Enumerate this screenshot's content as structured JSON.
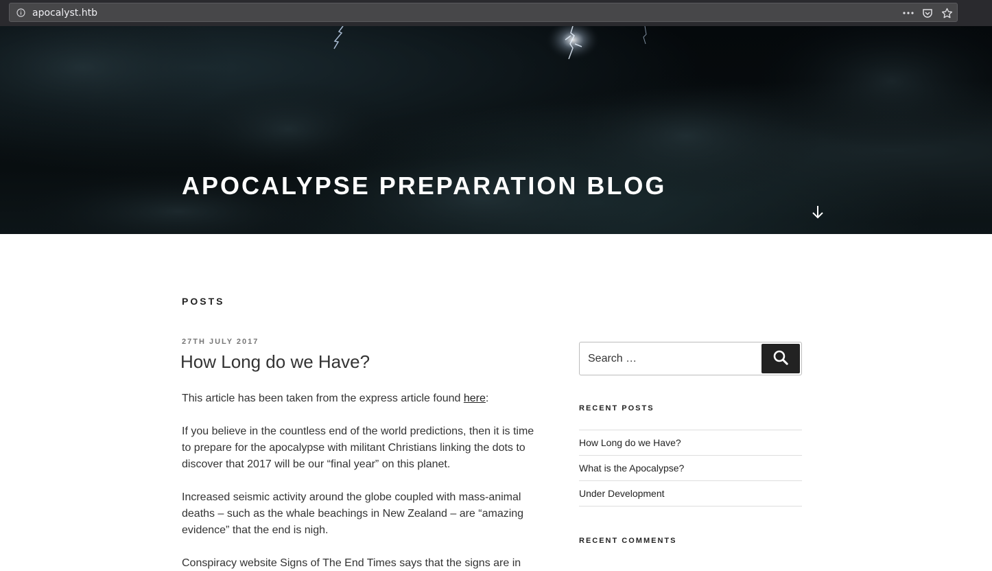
{
  "browser": {
    "url": "apocalyst.htb",
    "icons": [
      "info-icon",
      "more-actions-icon",
      "pocket-icon",
      "bookmark-star-icon"
    ]
  },
  "header": {
    "site_title": "APOCALYPSE PREPARATION BLOG",
    "scroll_icon": "arrow-down-icon"
  },
  "main": {
    "section_heading": "POSTS",
    "post": {
      "date": "27TH JULY 2017",
      "title": "How Long do we Have?",
      "intro_before_link": "This article has been taken from the express article found ",
      "intro_link": "here",
      "intro_after_link": ":",
      "paragraphs": [
        "If you believe in the countless end of the world predictions, then it is time to prepare for the apocalypse with militant Christians linking the dots to discover that 2017 will be our “final year” on this planet.",
        "Increased seismic activity around the globe coupled with mass-animal deaths – such as the whale beachings in New Zealand – are “amazing evidence” that the end is nigh.",
        "Conspiracy website Signs of The End Times says that the signs are in"
      ]
    }
  },
  "sidebar": {
    "search": {
      "placeholder": "Search …",
      "button_label": "Search",
      "icon": "search-icon"
    },
    "recent_posts": {
      "title": "RECENT POSTS",
      "items": [
        "How Long do we Have?",
        "What is the Apocalypse?",
        "Under Development"
      ]
    },
    "recent_comments": {
      "title": "RECENT COMMENTS"
    }
  },
  "colors": {
    "browser_bar": "#2a2a2e",
    "header_bg": "#070c0e",
    "title_text": "#ffffff",
    "body_text": "#333333",
    "date_text": "#767676",
    "search_button": "#222222"
  }
}
